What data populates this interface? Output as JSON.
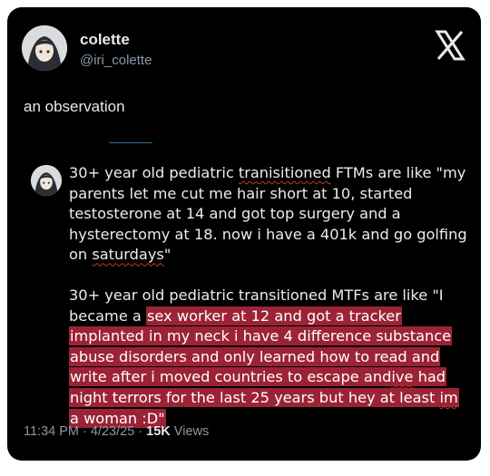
{
  "author": {
    "display_name": "colette",
    "handle": "@iri_colette",
    "avatar_icon": "anime-avatar-icon"
  },
  "platform_icon": "x-logo-icon",
  "tweet": {
    "text": "an observation"
  },
  "quote": {
    "avatar_icon": "anime-avatar-icon",
    "paragraph1": {
      "before": "30+ year old pediatric ",
      "misspelled": "tranisitioned",
      "middle": " FTMs are like \"my parents let me cut me hair short at 10, started testosterone at 14 and got top surgery and a hysterectomy at 18.  now i have a 401k and go golfing on ",
      "last_word": "saturdays",
      "end": "\""
    },
    "paragraph2": {
      "before": "30+ year old pediatric transitioned MTFs are like \"I became a ",
      "highlighted_a": "sex worker at 12 and got a tracker implanted in my neck  i have 4 difference substance abuse disorders and only learned how to read and write after i moved countries to escape and",
      "highlighted_ive": "ive",
      "highlighted_b": " had night terrors for the last 25 years but hey at least ",
      "highlighted_im": "im",
      "highlighted_c": " a woman :D\""
    },
    "highlight_color": "#9b2335"
  },
  "meta": {
    "time": "11:34 PM",
    "separator1": " · ",
    "date": "4/23/25",
    "separator2": " · ",
    "views_count": "15K",
    "views_label": " Views"
  }
}
